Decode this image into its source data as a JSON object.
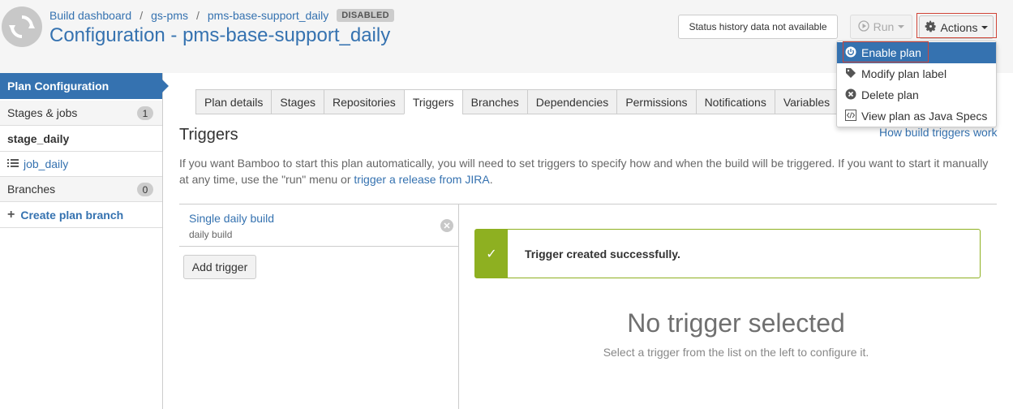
{
  "header": {
    "breadcrumb": [
      "Build dashboard",
      "gs-pms",
      "pms-base-support_daily"
    ],
    "status_badge": "DISABLED",
    "title": "Configuration - pms-base-support_daily",
    "status_button": "Status history data not available",
    "run_button": "Run",
    "actions_button": "Actions"
  },
  "actions_menu": {
    "items": [
      {
        "label": "Enable plan",
        "icon": "power-icon"
      },
      {
        "label": "Modify plan label",
        "icon": "tag-icon"
      },
      {
        "label": "Delete plan",
        "icon": "delete-icon"
      },
      {
        "label": "View plan as Java Specs",
        "icon": "code-icon"
      }
    ]
  },
  "sidebar": {
    "heading": "Plan Configuration",
    "stages_label": "Stages & jobs",
    "stages_count": "1",
    "stage_name": "stage_daily",
    "job_name": "job_daily",
    "branches_label": "Branches",
    "branches_count": "0",
    "create_branch": "Create plan branch"
  },
  "tabs": [
    "Plan details",
    "Stages",
    "Repositories",
    "Triggers",
    "Branches",
    "Dependencies",
    "Permissions",
    "Notifications",
    "Variables"
  ],
  "active_tab": "Triggers",
  "section": {
    "title": "Triggers",
    "help_link": "How build triggers work",
    "desc_part1": "If you want Bamboo to start this plan automatically, you will need to set triggers to specify how and when the build will be triggered. If you want to start it manually at any time, use the \"run\" menu or ",
    "desc_link": "trigger a release from JIRA",
    "desc_part2": "."
  },
  "triggers": [
    {
      "name": "Single daily build",
      "description": "daily build"
    }
  ],
  "add_trigger": "Add trigger",
  "success_message": "Trigger created successfully.",
  "empty_title": "No trigger selected",
  "empty_subtitle": "Select a trigger from the list on the left to configure it.",
  "colors": {
    "brand_blue": "#3572b0",
    "success_green": "#8eb021",
    "highlight_red": "#d04437"
  }
}
